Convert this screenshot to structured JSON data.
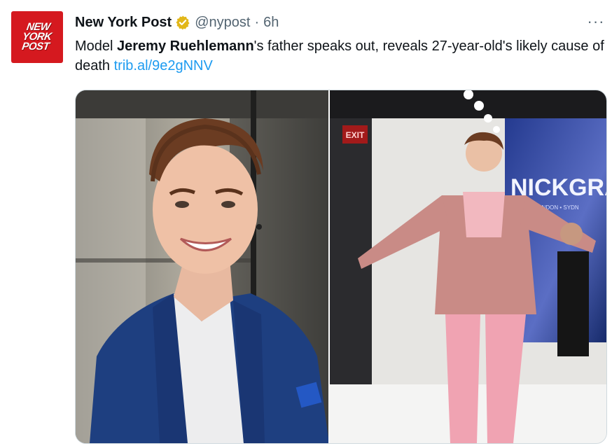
{
  "account": {
    "display_name": "New York Post",
    "handle": "@nypost",
    "separator": "·",
    "time": "6h",
    "avatar_text": [
      "NEW",
      "YORK",
      "POST"
    ]
  },
  "tweet": {
    "text_before": "Model ",
    "text_bold": "Jeremy Ruehlemann",
    "text_after": "'s father speaks out, reveals 27-year-old's likely cause of death ",
    "link": "trib.al/9e2gNNV"
  },
  "more_menu": "···",
  "media": {
    "right_photo_signs": {
      "exit": "EXIT",
      "backdrop": "NICKGRAH",
      "backdrop_sub": "YORK • LONDON • SYDN"
    }
  },
  "colors": {
    "brand_red": "#d5191f",
    "link_blue": "#1d9bf0",
    "verified_gold": "#e2b719",
    "secondary_text": "#536471"
  }
}
